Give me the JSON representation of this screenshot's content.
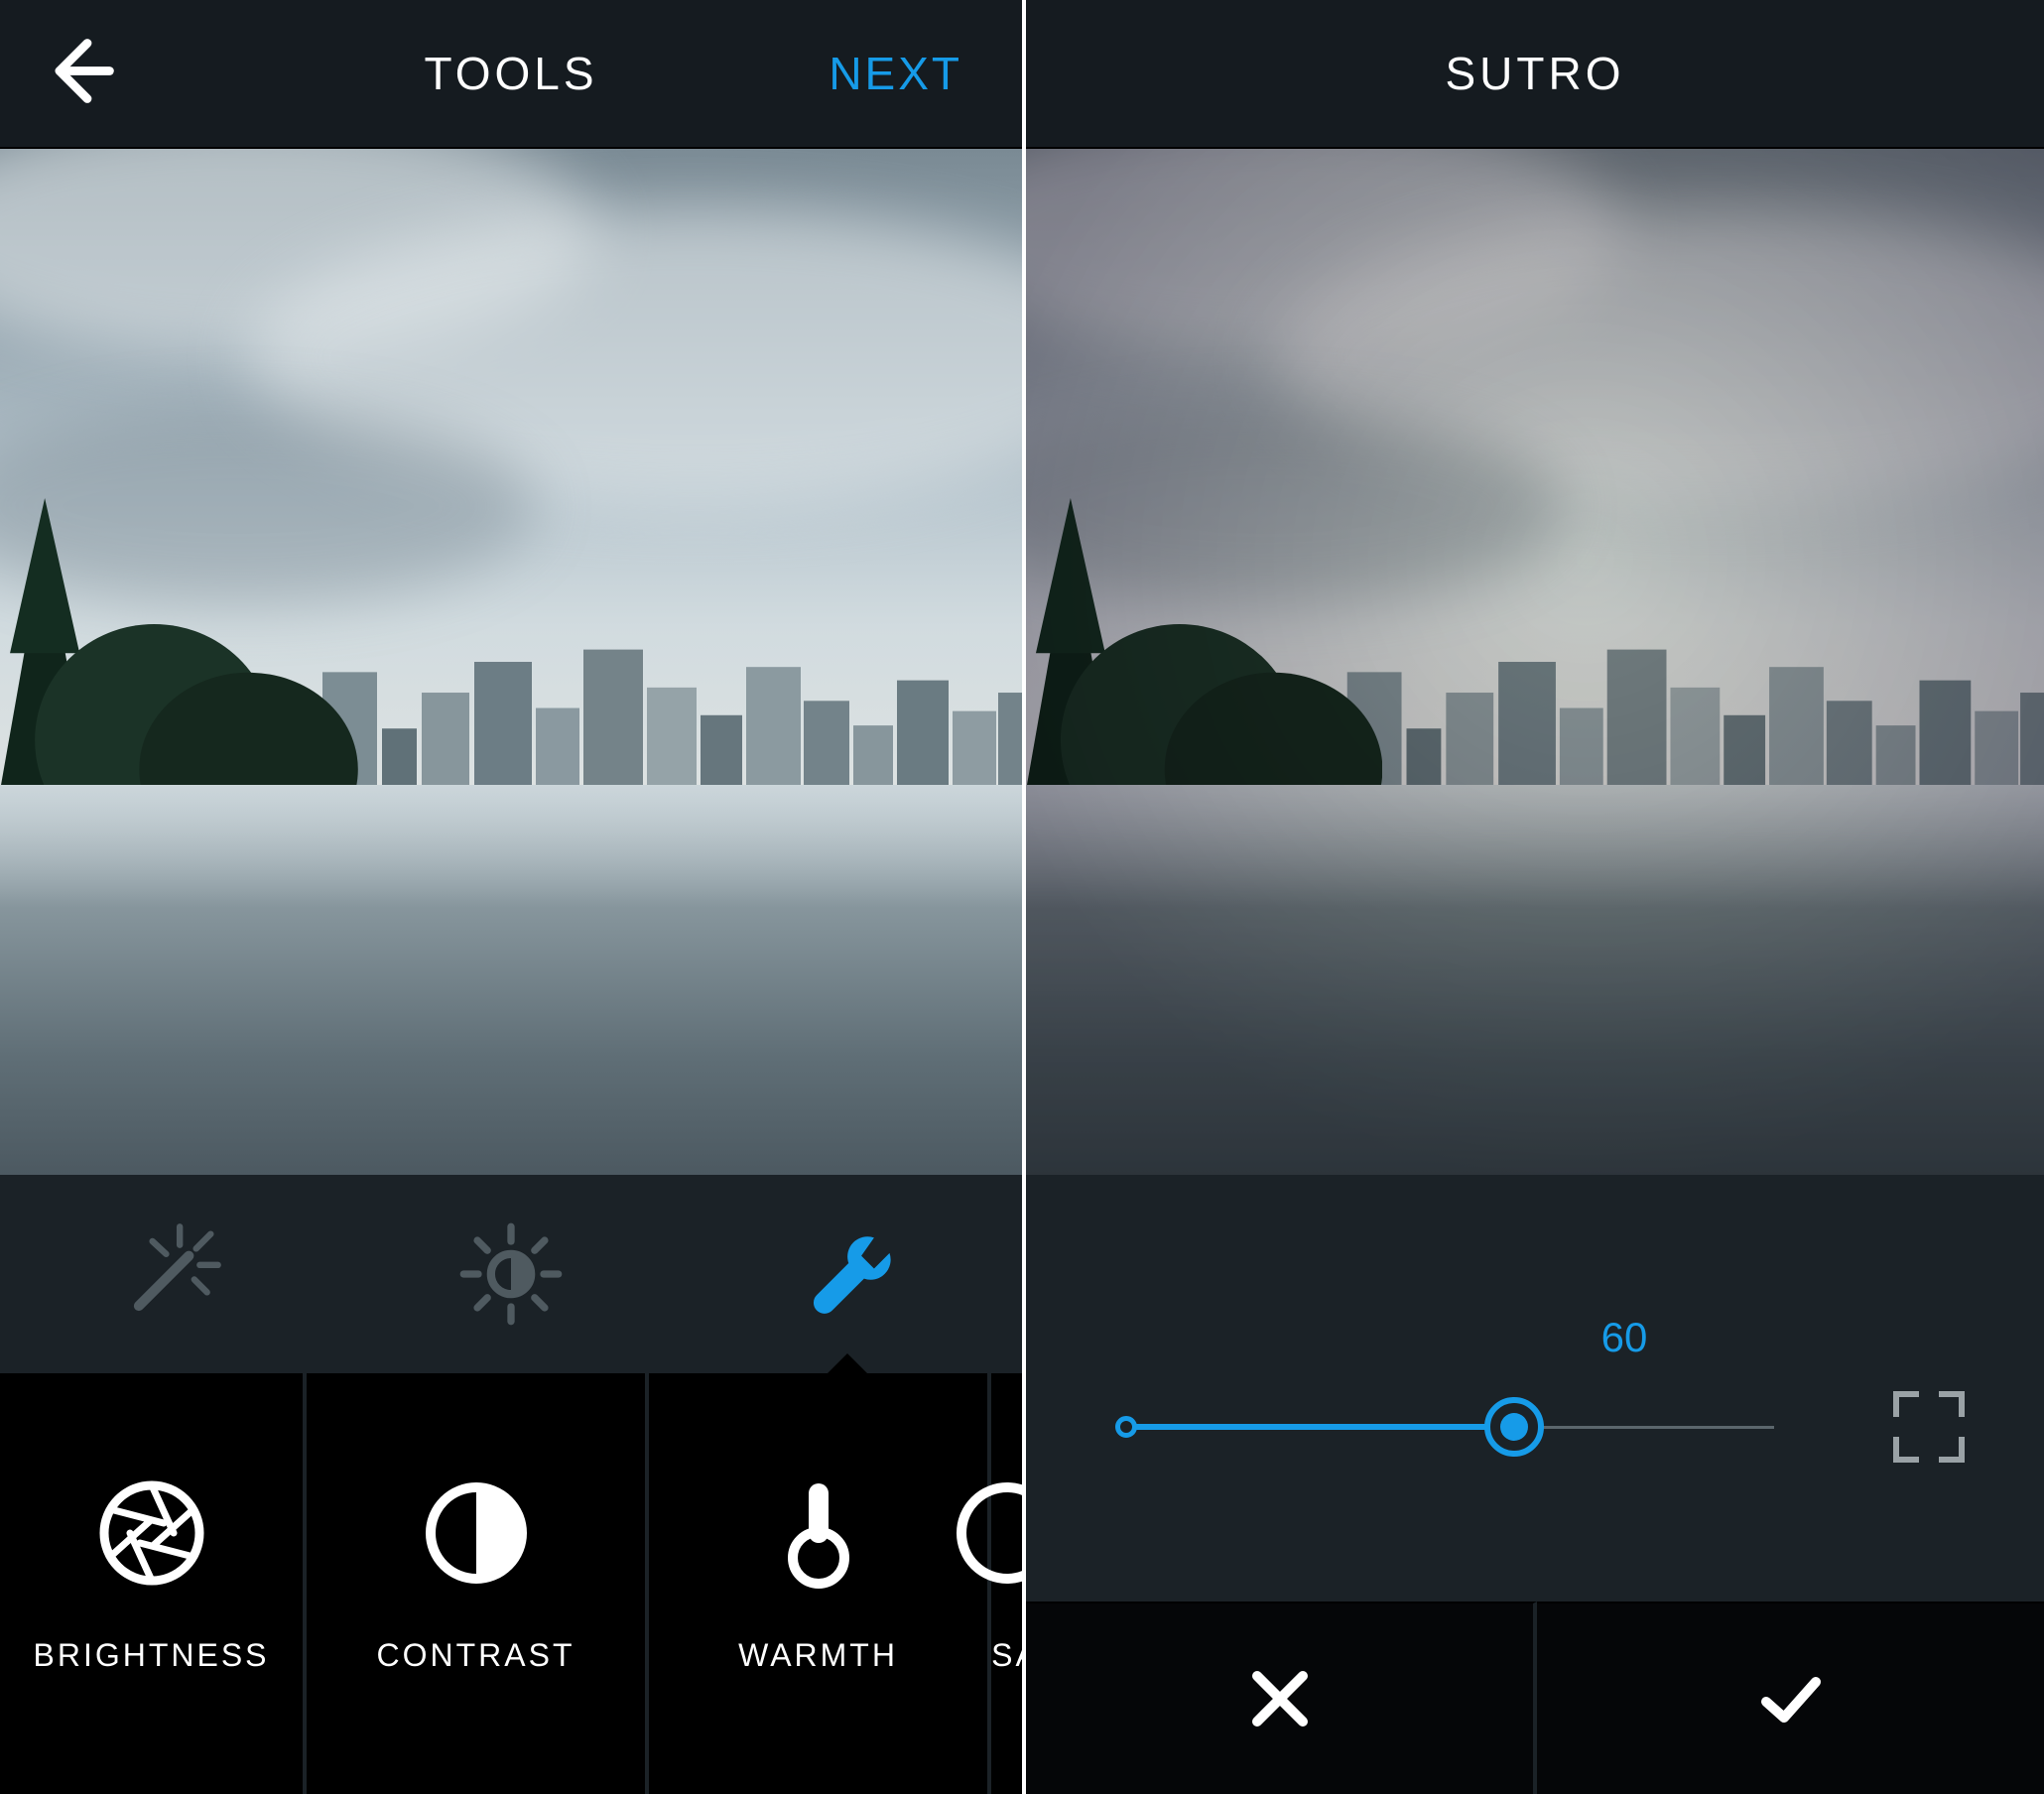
{
  "left": {
    "title": "TOOLS",
    "next_label": "NEXT",
    "tools": [
      {
        "id": "brightness",
        "label": "BRIGHTNESS"
      },
      {
        "id": "contrast",
        "label": "CONTRAST"
      },
      {
        "id": "warmth",
        "label": "WARMTH"
      },
      {
        "id": "saturation",
        "label": "SATU"
      }
    ],
    "tooltabs": [
      {
        "id": "magic",
        "active": false
      },
      {
        "id": "lux",
        "active": false
      },
      {
        "id": "wrench",
        "active": true
      }
    ]
  },
  "right": {
    "title": "SUTRO",
    "slider": {
      "value": 60,
      "min": 0,
      "max": 100
    },
    "frame_enabled": false
  },
  "colors": {
    "accent": "#169be8",
    "panel": "#1b2227",
    "header": "#151b20",
    "inactive_icon": "#4f5a60"
  }
}
